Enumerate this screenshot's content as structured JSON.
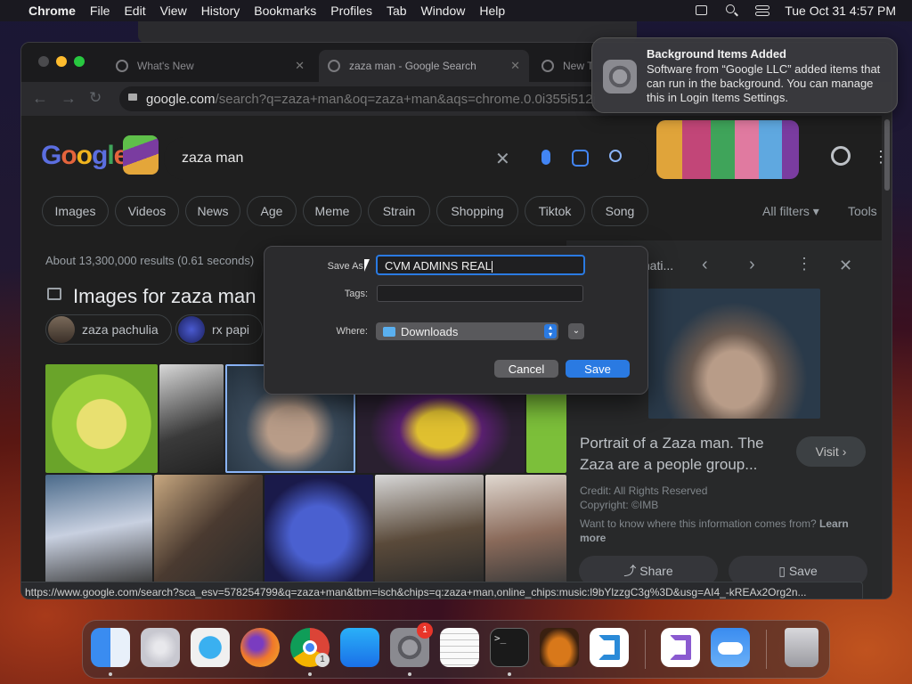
{
  "menubar": {
    "apple": "",
    "app": "Chrome",
    "items": [
      "File",
      "Edit",
      "View",
      "History",
      "Bookmarks",
      "Profiles",
      "Tab",
      "Window",
      "Help"
    ],
    "clock": "Tue Oct 31  4:57 PM"
  },
  "tabs": [
    {
      "label": "What's New"
    },
    {
      "label": "zaza man - Google Search"
    },
    {
      "label": "New T"
    }
  ],
  "omnibox": {
    "host": "google.com",
    "path": "/search?q=zaza+man&oq=zaza+man&aqs=chrome.0.0i355i512j"
  },
  "google": {
    "query": "zaza man",
    "chips": [
      "Images",
      "Videos",
      "News",
      "Age",
      "Meme",
      "Strain",
      "Shopping",
      "Tiktok",
      "Song"
    ],
    "all_filters": "All filters",
    "tools": "Tools",
    "stats": "About 13,300,000 results (0.61 seconds)",
    "images_title": "Images for zaza man",
    "related": [
      {
        "label": "zaza pachulia"
      },
      {
        "label": "rx papi"
      }
    ]
  },
  "panel": {
    "header": "mati...",
    "title": "Portrait of a Zaza man. The Zaza are a people group...",
    "visit": "Visit",
    "credit": "Credit: All Rights Reserved",
    "copyright": "Copyright: ©IMB",
    "info": "Want to know where this information comes from?",
    "learn": "Learn more",
    "share": "Share",
    "save": "Save"
  },
  "status_url": "https://www.google.com/search?sca_esv=578254799&q=zaza+man&tbm=isch&chips=q:zaza+man,online_chips:music:l9bYlzzgC3g%3D&usg=AI4_-kREAx2Org2n...",
  "notification": {
    "title": "Background Items Added",
    "body": "Software from “Google LLC” added items that can run in the background. You can manage this in Login Items Settings."
  },
  "dialog": {
    "save_as_label": "Save As:",
    "save_as_value": "CVM ADMINS REAL",
    "tags_label": "Tags:",
    "where_label": "Where:",
    "where_value": "Downloads",
    "cancel": "Cancel",
    "save": "Save"
  },
  "dock": [
    {
      "name": "Finder"
    },
    {
      "name": "Launchpad"
    },
    {
      "name": "Safari"
    },
    {
      "name": "Firefox"
    },
    {
      "name": "Chrome",
      "badge": "1"
    },
    {
      "name": "App Store"
    },
    {
      "name": "System Settings",
      "badge": "1"
    },
    {
      "name": "TextEdit"
    },
    {
      "name": "Terminal"
    },
    {
      "name": "GarageBand"
    },
    {
      "name": "Visual Studio Code"
    },
    {
      "name": "Visual Studio"
    },
    {
      "name": "Weather"
    },
    {
      "name": "Trash"
    }
  ]
}
